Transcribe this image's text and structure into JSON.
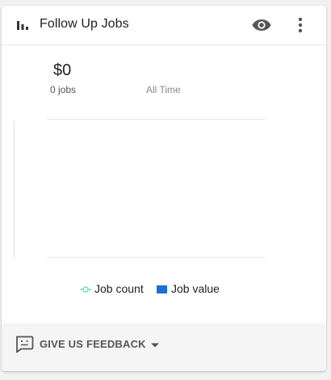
{
  "header": {
    "title": "Follow Up Jobs",
    "icons": {
      "chart": "bar-chart-icon",
      "visibility": "eye-icon",
      "more": "more-vert-icon"
    }
  },
  "stats": {
    "amount": "$0",
    "jobs": "0 jobs",
    "period": "All Time"
  },
  "legend": {
    "job_count": "Job count",
    "job_value": "Job value"
  },
  "colors": {
    "job_count": "#6fe1b3",
    "job_value": "#1d6fd1",
    "icon": "#555555",
    "axis": "#e0e0e0"
  },
  "footer": {
    "feedback_label": "GIVE US FEEDBACK",
    "icons": {
      "feedback": "feedback-icon",
      "caret": "caret-down-icon"
    }
  }
}
